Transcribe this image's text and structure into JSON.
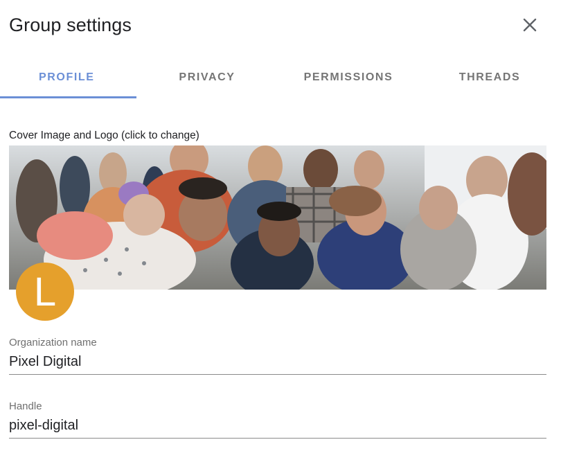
{
  "dialog": {
    "title": "Group settings",
    "close_icon": "close-icon"
  },
  "tabs": [
    {
      "label": "PROFILE",
      "active": true
    },
    {
      "label": "PRIVACY",
      "active": false
    },
    {
      "label": "PERMISSIONS",
      "active": false
    },
    {
      "label": "THREADS",
      "active": false
    }
  ],
  "profile": {
    "cover_label": "Cover Image and Logo (click to change)",
    "logo_letter": "L",
    "logo_color": "#e5a02c",
    "fields": {
      "org_name": {
        "label": "Organization name",
        "value": "Pixel Digital"
      },
      "handle": {
        "label": "Handle",
        "value": "pixel-digital"
      }
    }
  },
  "colors": {
    "accent": "#6b8fd6",
    "tab_inactive": "#757575"
  }
}
